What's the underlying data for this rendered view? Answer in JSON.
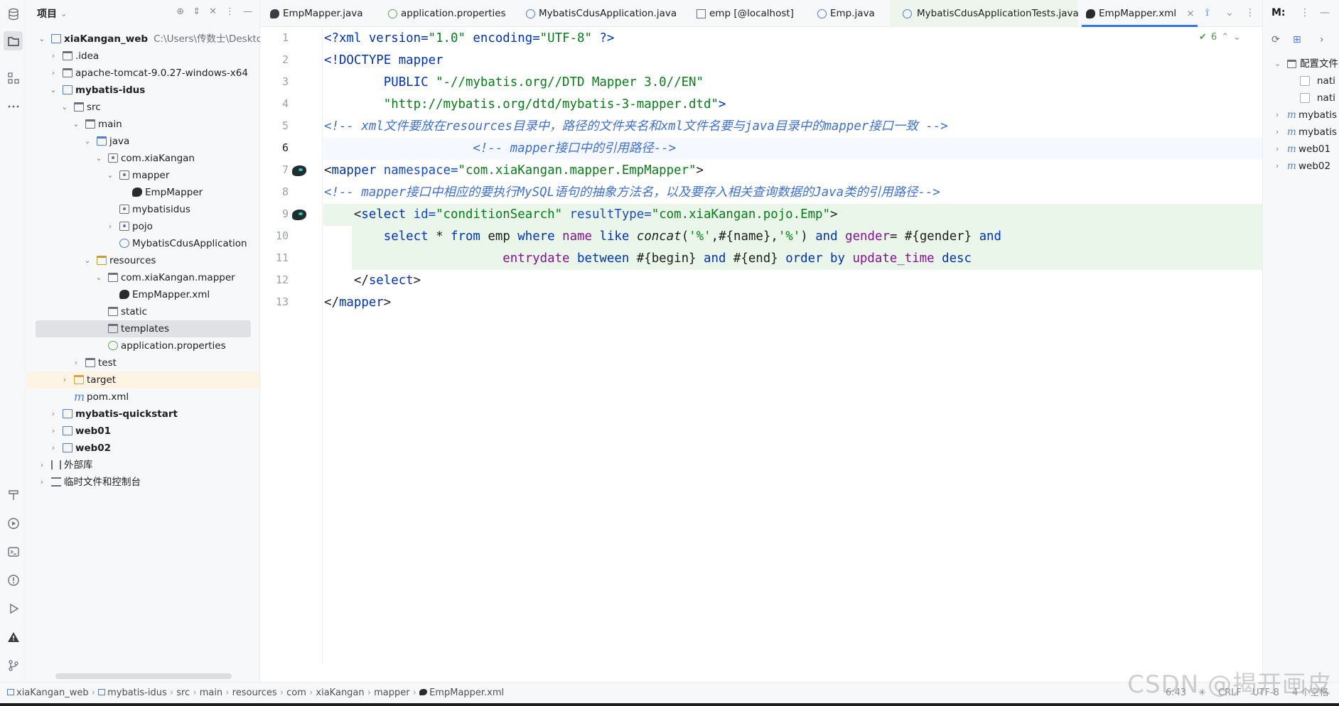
{
  "project": {
    "title": "项目",
    "tree": [
      {
        "label": "xiaKangan_web",
        "path": "C:\\Users\\传数士\\Desktop\\x",
        "bold": true
      },
      {
        "label": ".idea"
      },
      {
        "label": "apache-tomcat-9.0.27-windows-x64"
      },
      {
        "label": "mybatis-idus",
        "bold": true
      },
      {
        "label": "src"
      },
      {
        "label": "main"
      },
      {
        "label": "java"
      },
      {
        "label": "com.xiaKangan"
      },
      {
        "label": "mapper"
      },
      {
        "label": "EmpMapper"
      },
      {
        "label": "mybatisidus"
      },
      {
        "label": "pojo"
      },
      {
        "label": "MybatisCdusApplication"
      },
      {
        "label": "resources"
      },
      {
        "label": "com.xiaKangan.mapper"
      },
      {
        "label": "EmpMapper.xml"
      },
      {
        "label": "static"
      },
      {
        "label": "templates"
      },
      {
        "label": "application.properties"
      },
      {
        "label": "test"
      },
      {
        "label": "target"
      },
      {
        "label": "pom.xml"
      },
      {
        "label": "mybatis-quickstart",
        "bold": true
      },
      {
        "label": "web01",
        "bold": true
      },
      {
        "label": "web02",
        "bold": true
      },
      {
        "label": "外部库"
      },
      {
        "label": "临时文件和控制台"
      }
    ]
  },
  "tabs": [
    {
      "label": "EmpMapper.java",
      "icon": "java-interface-icon"
    },
    {
      "label": "application.properties",
      "icon": "spring-leaf-icon"
    },
    {
      "label": "MybatisCdusApplication.java",
      "icon": "spring-class-icon"
    },
    {
      "label": "emp [@localhost]",
      "icon": "table-icon"
    },
    {
      "label": "Emp.java",
      "icon": "java-class-icon"
    },
    {
      "label": "MybatisCdusApplicationTests.java",
      "icon": "test-class-icon"
    },
    {
      "label": "EmpMapper.xml",
      "icon": "mybatis-bird-icon",
      "active": true
    }
  ],
  "editor": {
    "inspection_count": "6",
    "current_line": 6,
    "line_numbers": [
      "1",
      "2",
      "3",
      "4",
      "5",
      "6",
      "7",
      "8",
      "9",
      "10",
      "11",
      "12",
      "13"
    ],
    "code": {
      "l1": {
        "a": "<?xml version=",
        "b": "\"1.0\"",
        "c": " encoding=",
        "d": "\"UTF-8\"",
        "e": " ?>"
      },
      "l2": {
        "a": "<!DOCTYPE ",
        "b": "mapper"
      },
      "l3": {
        "a": "        PUBLIC ",
        "b": "\"-//mybatis.org//DTD Mapper 3.0//EN\""
      },
      "l4": {
        "a": "        ",
        "b": "\"http://mybatis.org/dtd/mybatis-3-mapper.dtd\"",
        "c": ">"
      },
      "l5": {
        "a": "<!-- xml文件要放在resources目录中，路径的文件夹名和xml文件名要与java目录中的mapper接口一致 -->"
      },
      "l6": {
        "a": "                    ",
        "b": "<!-- mapper接口中的引用路径-->"
      },
      "l7": {
        "a": "<",
        "b": "mapper",
        "c": " namespace=",
        "d": "\"com.xiaKangan.mapper.EmpMapper\"",
        "e": ">"
      },
      "l8": {
        "a": "<!-- mapper接口中相应的要执行MySQL语句的抽象方法名，以及要存入相关查询数据的Java类的引用路径-->"
      },
      "l9": {
        "a": "    <",
        "b": "select",
        "c": " id=",
        "d": "\"conditionSearch\"",
        "e": " resultType=",
        "f": "\"com.xiaKangan.pojo.Emp\"",
        "g": ">"
      },
      "l10": {
        "a": "        ",
        "b": "select",
        "c": " * ",
        "d": "from",
        "e": " emp ",
        "f": "where",
        "g": " ",
        "h": "name",
        "i": " ",
        "j": "like",
        "k": " ",
        "l": "concat",
        "m": "(",
        "n": "'%'",
        "o": ",#{name},",
        "p": "'%'",
        "q": ") ",
        "r": "and",
        "s": " ",
        "t": "gender",
        "u": "= #{gender} ",
        "v": "and"
      },
      "l11": {
        "a": "                        ",
        "b": "entrydate",
        "c": " ",
        "d": "between",
        "e": " #{begin} ",
        "f": "and",
        "g": " #{end} ",
        "h": "order by",
        "i": " ",
        "j": "update_time",
        "k": " ",
        "l": "desc"
      },
      "l12": {
        "a": "    </",
        "b": "select",
        "c": ">"
      },
      "l13": {
        "a": "</",
        "b": "mapper",
        "c": ">"
      }
    }
  },
  "right_pane": {
    "title": "M:",
    "items": [
      {
        "label": "配置文件",
        "kind": "folder"
      },
      {
        "label": "nati",
        "kind": "checkbox"
      },
      {
        "label": "nati",
        "kind": "checkbox"
      },
      {
        "label": "mybatis",
        "kind": "module"
      },
      {
        "label": "mybatis",
        "kind": "module"
      },
      {
        "label": "web01",
        "kind": "module"
      },
      {
        "label": "web02",
        "kind": "module"
      }
    ]
  },
  "statusbar": {
    "breadcrumbs": [
      "xiaKangan_web",
      "mybatis-idus",
      "src",
      "main",
      "resources",
      "com",
      "xiaKangan",
      "mapper",
      "EmpMapper.xml"
    ],
    "position": "6:43",
    "line_sep": "CRLF",
    "encoding": "UTF-8",
    "indent": "4 个空格"
  },
  "watermark": "CSDN @揭开画皮",
  "colors": {
    "accent": "#3574f0",
    "keyword": "#0033b3",
    "string": "#067d17",
    "comment": "#3e70d1"
  }
}
